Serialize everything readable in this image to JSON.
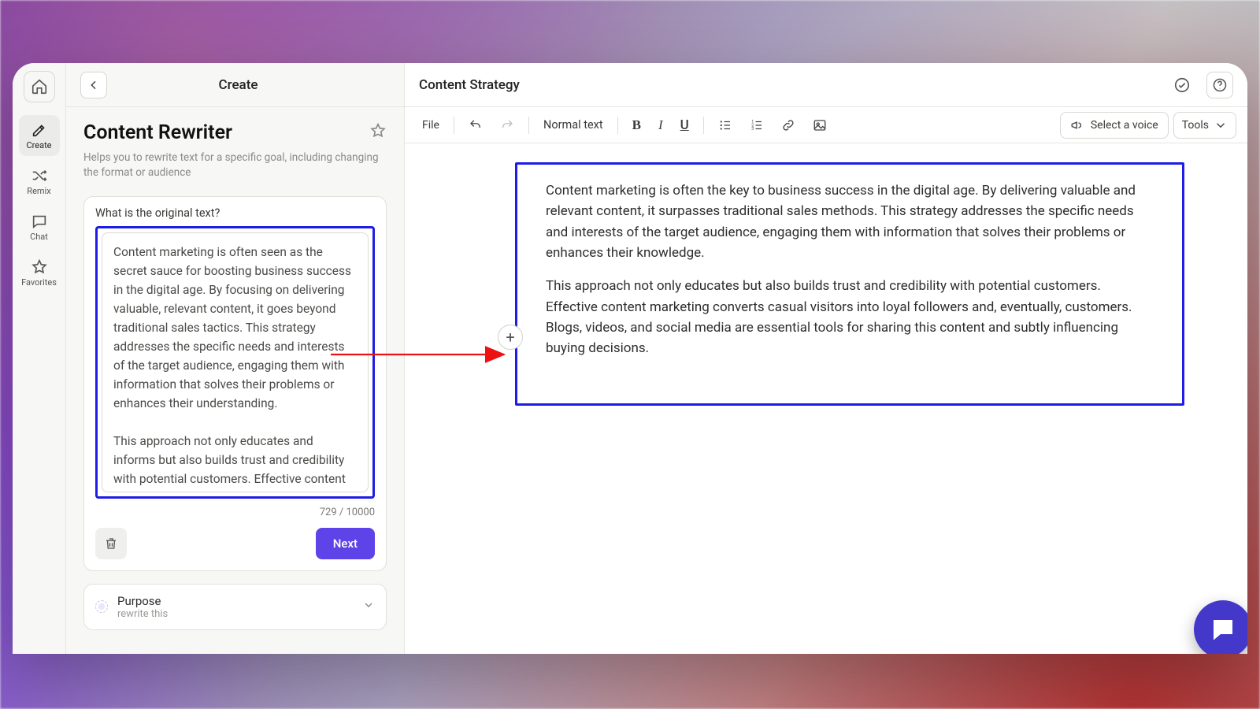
{
  "rail": {
    "home": "",
    "create": "Create",
    "remix": "Remix",
    "chat": "Chat",
    "favorites": "Favorites"
  },
  "leftHeader": {
    "title": "Create"
  },
  "tool": {
    "title": "Content Rewriter",
    "subtitle": "Helps you to rewrite text for a specific goal, including changing the format or audience"
  },
  "original": {
    "label": "What is the original text?",
    "text": "Content marketing is often seen as the secret sauce for boosting business success in the digital age. By focusing on delivering valuable, relevant content, it goes beyond traditional sales tactics. This strategy addresses the specific needs and interests of the target audience, engaging them with information that solves their problems or enhances their understanding.\n\nThis approach not only educates and informs but also builds trust and credibility with potential customers. Effective content marketing turns casual browsers into loyal followers and, ultimately,",
    "counter": "729 / 10000",
    "nextLabel": "Next"
  },
  "purpose": {
    "title": "Purpose",
    "value": "rewrite this"
  },
  "rightHeader": {
    "title": "Content Strategy"
  },
  "toolbar": {
    "file": "File",
    "normal": "Normal text",
    "voice": "Select a voice",
    "tools": "Tools"
  },
  "output": {
    "p1": "Content marketing is often the key to business success in the digital age. By delivering valuable and relevant content, it surpasses traditional sales methods. This strategy addresses the specific needs and interests of the target audience, engaging them with information that solves their problems or enhances their knowledge.",
    "p2": "This approach not only educates but also builds trust and credibility with potential customers. Effective content marketing converts casual visitors into loyal followers and, eventually, customers. Blogs, videos, and social media are essential tools for sharing this content and subtly influencing buying decisions."
  }
}
